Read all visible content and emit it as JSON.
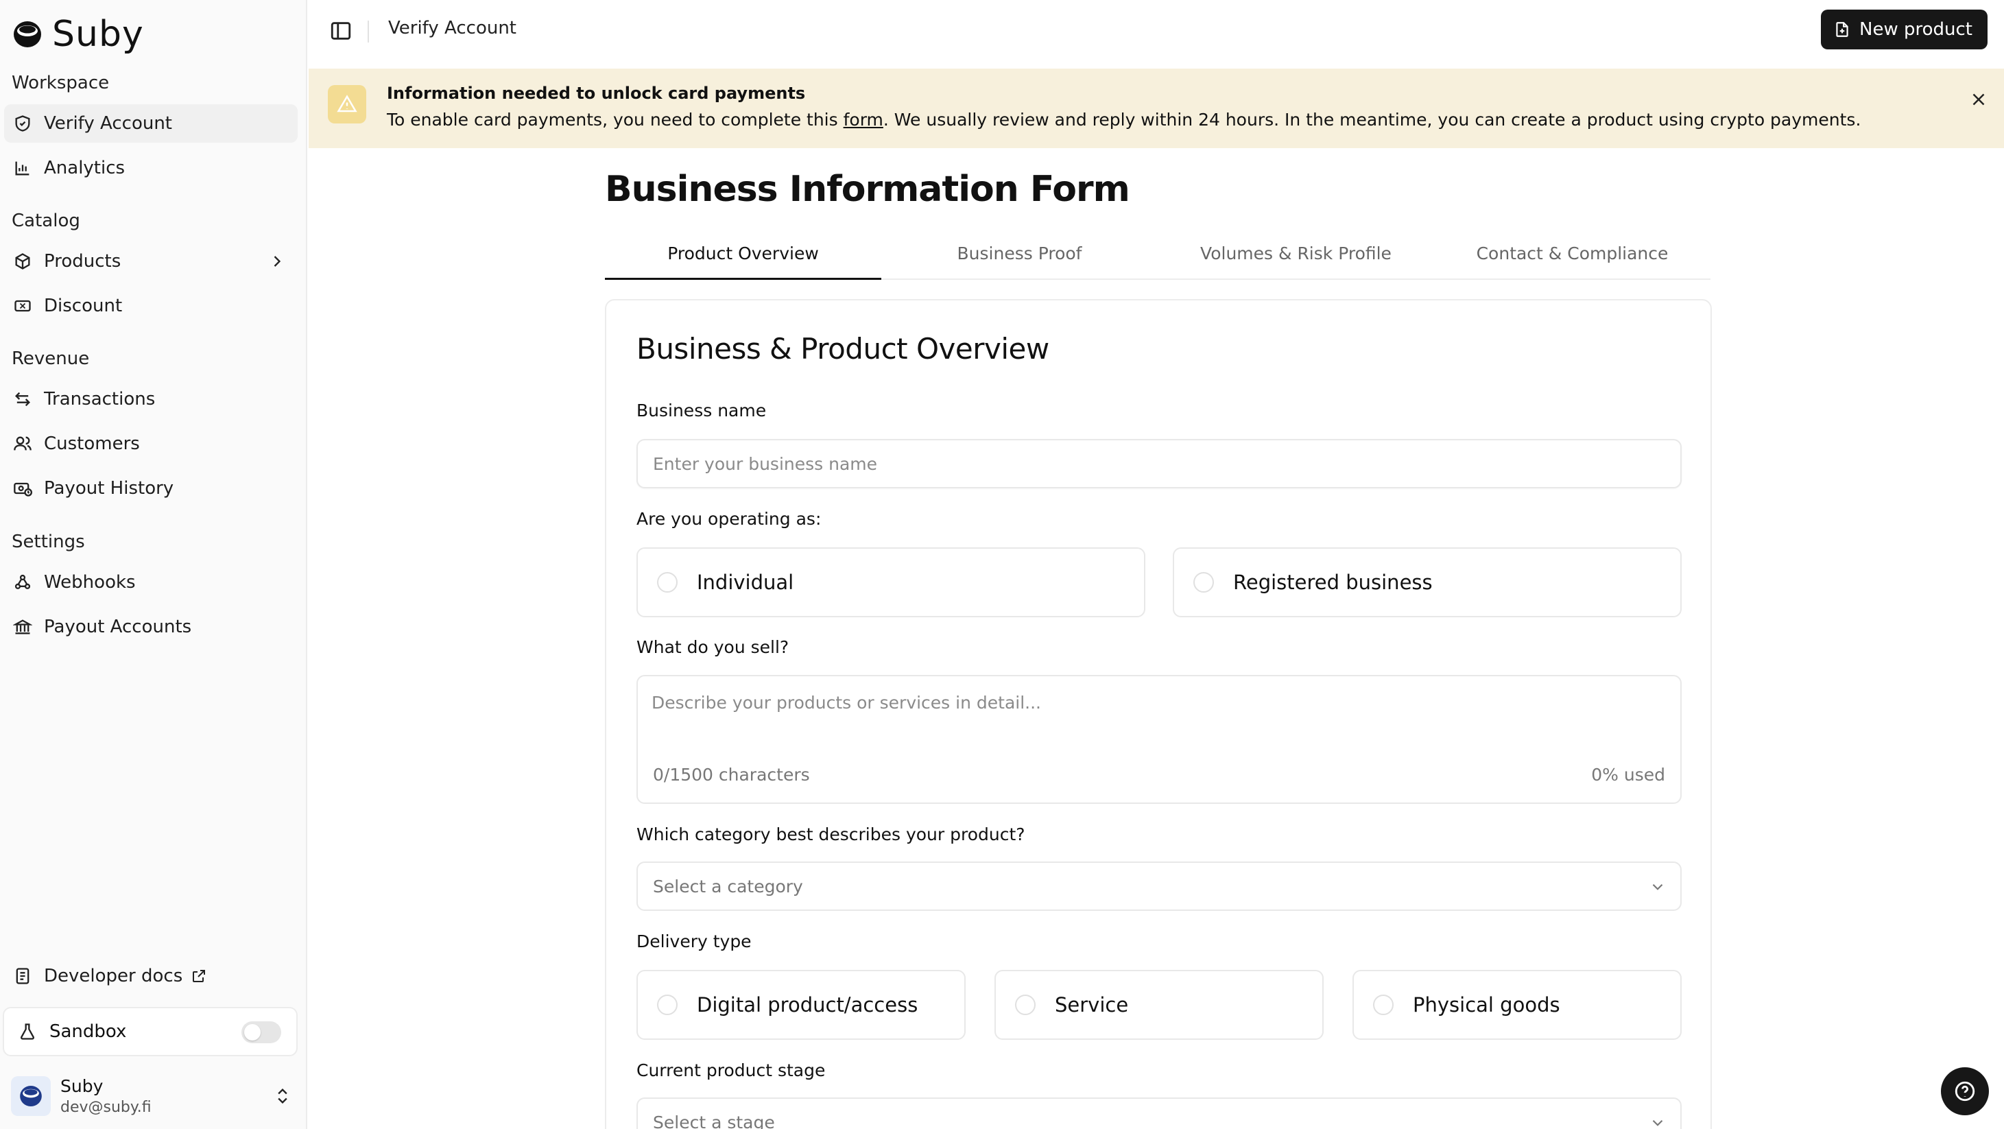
{
  "app": {
    "name": "Suby"
  },
  "sidebar": {
    "groups": [
      {
        "label": "Workspace",
        "items": [
          {
            "label": "Verify Account",
            "icon": "shield-check-icon",
            "active": true
          },
          {
            "label": "Analytics",
            "icon": "bar-chart-icon"
          }
        ]
      },
      {
        "label": "Catalog",
        "items": [
          {
            "label": "Products",
            "icon": "package-icon"
          },
          {
            "label": "Discount",
            "icon": "ticket-icon"
          }
        ]
      },
      {
        "label": "Revenue",
        "items": [
          {
            "label": "Transactions",
            "icon": "arrows-swap-icon"
          },
          {
            "label": "Customers",
            "icon": "users-icon"
          },
          {
            "label": "Payout History",
            "icon": "banknote-history-icon"
          }
        ]
      },
      {
        "label": "Settings",
        "items": [
          {
            "label": "Webhooks",
            "icon": "webhook-icon"
          },
          {
            "label": "Payout Accounts",
            "icon": "bank-icon"
          }
        ]
      }
    ],
    "developer_docs": "Developer docs",
    "sandbox_label": "Sandbox",
    "sandbox_enabled": false,
    "account": {
      "name": "Suby",
      "email": "dev@suby.fi"
    }
  },
  "header": {
    "title": "Verify Account",
    "new_product_label": "New product"
  },
  "banner": {
    "title": "Information needed to unlock card payments",
    "text_before": "To enable card payments, you need to complete this ",
    "link_text": "form",
    "text_after": ". We usually review and reply within 24 hours. In the meantime, you can create a product using crypto payments."
  },
  "form": {
    "page_title": "Business Information Form",
    "tabs": [
      "Product Overview",
      "Business Proof",
      "Volumes & Risk Profile",
      "Contact & Compliance"
    ],
    "active_tab": 0,
    "card_title": "Business & Product Overview",
    "business_name": {
      "label": "Business name",
      "placeholder": "Enter your business name",
      "value": ""
    },
    "operating_as": {
      "label": "Are you operating as:",
      "options": [
        "Individual",
        "Registered business"
      ]
    },
    "sell": {
      "label": "What do you sell?",
      "placeholder": "Describe your products or services in detail...",
      "count": "0/1500 characters",
      "percent": "0% used"
    },
    "category": {
      "label": "Which category best describes your product?",
      "placeholder": "Select a category"
    },
    "delivery": {
      "label": "Delivery type",
      "options": [
        "Digital product/access",
        "Service",
        "Physical goods"
      ]
    },
    "stage": {
      "label": "Current product stage",
      "placeholder": "Select a stage"
    }
  },
  "colors": {
    "banner_bg": "#f7f0dc",
    "banner_icon_bg": "#f3dc93",
    "primary_button": "#171717"
  }
}
